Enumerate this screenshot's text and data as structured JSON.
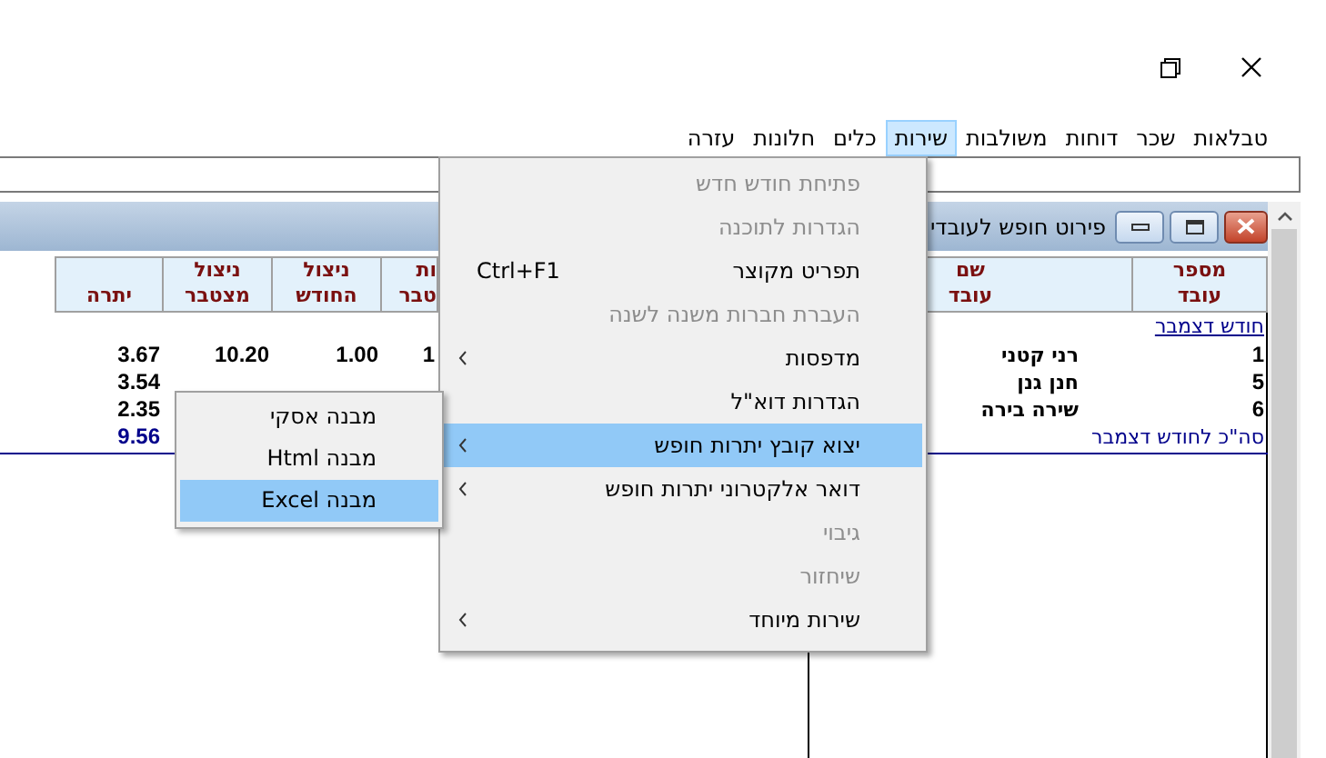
{
  "menubar": [
    {
      "label": "טבלאות",
      "selected": false
    },
    {
      "label": "שכר",
      "selected": false
    },
    {
      "label": "דוחות",
      "selected": false
    },
    {
      "label": "משולבות",
      "selected": false
    },
    {
      "label": "שירות",
      "selected": true
    },
    {
      "label": "כלים",
      "selected": false
    },
    {
      "label": "חלונות",
      "selected": false
    },
    {
      "label": "עזרה",
      "selected": false
    }
  ],
  "child_window": {
    "title": "פירוט חופש לעובדי",
    "table": {
      "columns": {
        "number": "מספר\nעובד",
        "name": "שם\nעובד",
        "column_4": "ות\nטבר",
        "used_month": "ניצול\nהחודש",
        "used_total": "ניצול\nמצטבר",
        "balance": "יתרה"
      },
      "group": "חודש דצמבר",
      "rows": [
        {
          "number": "1",
          "name": "רני קטני",
          "column_4": "1",
          "used_month": "1.00",
          "used_total": "10.20",
          "balance": "3.67"
        },
        {
          "number": "5",
          "name": "חנן גנן",
          "balance": "3.54"
        },
        {
          "number": "6",
          "name": "שירה בירה",
          "balance": "2.35"
        }
      ],
      "total": {
        "label": "סה\"כ לחודש דצמבר",
        "balance": "9.56"
      }
    }
  },
  "dropdown": [
    {
      "label": "פתיחת חודש חדש",
      "disabled": true,
      "submenu": false,
      "selected": false
    },
    {
      "label": "הגדרות לתוכנה",
      "disabled": true,
      "submenu": false,
      "selected": false
    },
    {
      "label": "תפריט מקוצר",
      "shortcut": "Ctrl+F1",
      "disabled": false,
      "submenu": false,
      "selected": false
    },
    {
      "label": "העברת חברות משנה לשנה",
      "disabled": true,
      "submenu": false,
      "selected": false
    },
    {
      "label": "מדפסות",
      "disabled": false,
      "submenu": true,
      "selected": false
    },
    {
      "label": "הגדרות דוא\"ל",
      "disabled": false,
      "submenu": false,
      "selected": false
    },
    {
      "label": "יצוא קובץ יתרות חופש",
      "disabled": false,
      "submenu": true,
      "selected": true
    },
    {
      "label": "דואר אלקטרוני יתרות חופש",
      "disabled": false,
      "submenu": true,
      "selected": false
    },
    {
      "label": "גיבוי",
      "disabled": true,
      "submenu": false,
      "selected": false
    },
    {
      "label": "שיחזור",
      "disabled": true,
      "submenu": false,
      "selected": false
    },
    {
      "label": "שירות מיוחד",
      "disabled": false,
      "submenu": true,
      "selected": false
    }
  ],
  "submenu": [
    {
      "label": "מבנה אסקי",
      "selected": false
    },
    {
      "label": "מבנה Html",
      "selected": false
    },
    {
      "label": "מבנה Excel",
      "selected": true
    }
  ]
}
